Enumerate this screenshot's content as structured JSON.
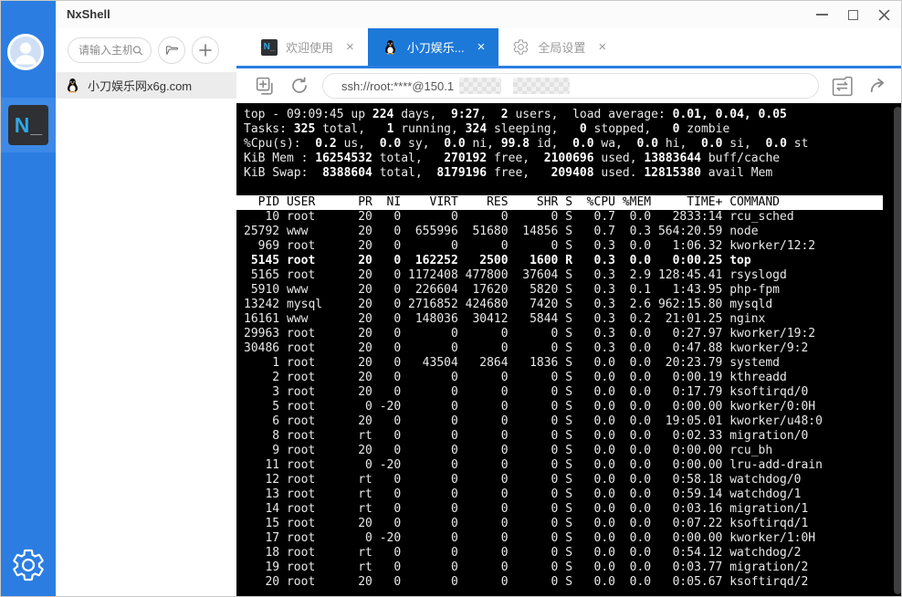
{
  "titlebar": {
    "app_title": "NxShell"
  },
  "logo": {
    "n": "N",
    "underscore": "_"
  },
  "host_panel": {
    "search_placeholder": "请输入主机",
    "host_item_label": "小刀娱乐网x6g.com"
  },
  "tabs": [
    {
      "label": "欢迎使用",
      "icon": "nxshell-logo",
      "close": "×",
      "active": false
    },
    {
      "label": "小刀娱乐...",
      "icon": "tux-penguin",
      "close": "×",
      "active": true
    },
    {
      "label": "全局设置",
      "icon": "gear",
      "close": "×",
      "active": false
    }
  ],
  "toolbar": {
    "address_visible": "ssh://root:****@150.1"
  },
  "colors": {
    "sidebar_blue": "#2b7de2",
    "active_tab_blue": "#1d79d8",
    "terminal_bg": "#000000",
    "terminal_text": "#e9e9e9"
  },
  "terminal": {
    "summary_lines": [
      [
        [
          "top - 09:09:45 up ",
          0
        ],
        [
          "224",
          1
        ],
        [
          " days,  ",
          0
        ],
        [
          "9:27",
          1
        ],
        [
          ",  ",
          0
        ],
        [
          "2",
          1
        ],
        [
          " users,  load average: ",
          0
        ],
        [
          "0.01, 0.04, 0.05",
          1
        ]
      ],
      [
        [
          "Tasks: ",
          0
        ],
        [
          "325",
          1
        ],
        [
          " total,   ",
          0
        ],
        [
          "1",
          1
        ],
        [
          " running, ",
          0
        ],
        [
          "324",
          1
        ],
        [
          " sleeping,   ",
          0
        ],
        [
          "0",
          1
        ],
        [
          " stopped,   ",
          0
        ],
        [
          "0",
          1
        ],
        [
          " zombie",
          0
        ]
      ],
      [
        [
          "%Cpu(s):  ",
          0
        ],
        [
          "0.2",
          1
        ],
        [
          " us,  ",
          0
        ],
        [
          "0.0",
          1
        ],
        [
          " sy,  ",
          0
        ],
        [
          "0.0",
          1
        ],
        [
          " ni, ",
          0
        ],
        [
          "99.8",
          1
        ],
        [
          " id,  ",
          0
        ],
        [
          "0.0",
          1
        ],
        [
          " wa,  ",
          0
        ],
        [
          "0.0",
          1
        ],
        [
          " hi,  ",
          0
        ],
        [
          "0.0",
          1
        ],
        [
          " si,  ",
          0
        ],
        [
          "0.0",
          1
        ],
        [
          " st",
          0
        ]
      ],
      [
        [
          "KiB Mem : ",
          0
        ],
        [
          "16254532",
          1
        ],
        [
          " total,   ",
          0
        ],
        [
          "270192",
          1
        ],
        [
          " free,  ",
          0
        ],
        [
          "2100696",
          1
        ],
        [
          " used, ",
          0
        ],
        [
          "13883644",
          1
        ],
        [
          " buff/cache",
          0
        ]
      ],
      [
        [
          "KiB Swap:  ",
          0
        ],
        [
          "8388604",
          1
        ],
        [
          " total,  ",
          0
        ],
        [
          "8179196",
          1
        ],
        [
          " free,   ",
          0
        ],
        [
          "209408",
          1
        ],
        [
          " used. ",
          0
        ],
        [
          "12815380",
          1
        ],
        [
          " avail Mem",
          0
        ]
      ]
    ],
    "table_columns": [
      "PID",
      "USER",
      "PR",
      "NI",
      "VIRT",
      "RES",
      "SHR",
      "S",
      "%CPU",
      "%MEM",
      "TIME+",
      "COMMAND"
    ],
    "highlight_row_index": 3,
    "process_rows": [
      [
        "10",
        "root",
        "20",
        "0",
        "0",
        "0",
        "0",
        "S",
        "0.7",
        "0.0",
        "2833:14",
        "rcu_sched"
      ],
      [
        "25792",
        "www",
        "20",
        "0",
        "655996",
        "51680",
        "14856",
        "S",
        "0.7",
        "0.3",
        "564:20.59",
        "node"
      ],
      [
        "969",
        "root",
        "20",
        "0",
        "0",
        "0",
        "0",
        "S",
        "0.3",
        "0.0",
        "1:06.32",
        "kworker/12:2"
      ],
      [
        "5145",
        "root",
        "20",
        "0",
        "162252",
        "2500",
        "1600",
        "R",
        "0.3",
        "0.0",
        "0:00.25",
        "top"
      ],
      [
        "5165",
        "root",
        "20",
        "0",
        "1172408",
        "477800",
        "37604",
        "S",
        "0.3",
        "2.9",
        "128:45.41",
        "rsyslogd"
      ],
      [
        "5910",
        "www",
        "20",
        "0",
        "226604",
        "17620",
        "5820",
        "S",
        "0.3",
        "0.1",
        "1:43.95",
        "php-fpm"
      ],
      [
        "13242",
        "mysql",
        "20",
        "0",
        "2716852",
        "424680",
        "7420",
        "S",
        "0.3",
        "2.6",
        "962:15.80",
        "mysqld"
      ],
      [
        "16161",
        "www",
        "20",
        "0",
        "148036",
        "30412",
        "5844",
        "S",
        "0.3",
        "0.2",
        "21:01.25",
        "nginx"
      ],
      [
        "29963",
        "root",
        "20",
        "0",
        "0",
        "0",
        "0",
        "S",
        "0.3",
        "0.0",
        "0:27.97",
        "kworker/19:2"
      ],
      [
        "30486",
        "root",
        "20",
        "0",
        "0",
        "0",
        "0",
        "S",
        "0.3",
        "0.0",
        "0:47.88",
        "kworker/9:2"
      ],
      [
        "1",
        "root",
        "20",
        "0",
        "43504",
        "2864",
        "1836",
        "S",
        "0.0",
        "0.0",
        "20:23.79",
        "systemd"
      ],
      [
        "2",
        "root",
        "20",
        "0",
        "0",
        "0",
        "0",
        "S",
        "0.0",
        "0.0",
        "0:00.19",
        "kthreadd"
      ],
      [
        "3",
        "root",
        "20",
        "0",
        "0",
        "0",
        "0",
        "S",
        "0.0",
        "0.0",
        "0:17.79",
        "ksoftirqd/0"
      ],
      [
        "5",
        "root",
        "0",
        "-20",
        "0",
        "0",
        "0",
        "S",
        "0.0",
        "0.0",
        "0:00.00",
        "kworker/0:0H"
      ],
      [
        "6",
        "root",
        "20",
        "0",
        "0",
        "0",
        "0",
        "S",
        "0.0",
        "0.0",
        "19:05.01",
        "kworker/u48:0"
      ],
      [
        "8",
        "root",
        "rt",
        "0",
        "0",
        "0",
        "0",
        "S",
        "0.0",
        "0.0",
        "0:02.33",
        "migration/0"
      ],
      [
        "9",
        "root",
        "20",
        "0",
        "0",
        "0",
        "0",
        "S",
        "0.0",
        "0.0",
        "0:00.00",
        "rcu_bh"
      ],
      [
        "11",
        "root",
        "0",
        "-20",
        "0",
        "0",
        "0",
        "S",
        "0.0",
        "0.0",
        "0:00.00",
        "lru-add-drain"
      ],
      [
        "12",
        "root",
        "rt",
        "0",
        "0",
        "0",
        "0",
        "S",
        "0.0",
        "0.0",
        "0:58.18",
        "watchdog/0"
      ],
      [
        "13",
        "root",
        "rt",
        "0",
        "0",
        "0",
        "0",
        "S",
        "0.0",
        "0.0",
        "0:59.14",
        "watchdog/1"
      ],
      [
        "14",
        "root",
        "rt",
        "0",
        "0",
        "0",
        "0",
        "S",
        "0.0",
        "0.0",
        "0:03.16",
        "migration/1"
      ],
      [
        "15",
        "root",
        "20",
        "0",
        "0",
        "0",
        "0",
        "S",
        "0.0",
        "0.0",
        "0:07.22",
        "ksoftirqd/1"
      ],
      [
        "17",
        "root",
        "0",
        "-20",
        "0",
        "0",
        "0",
        "S",
        "0.0",
        "0.0",
        "0:00.00",
        "kworker/1:0H"
      ],
      [
        "18",
        "root",
        "rt",
        "0",
        "0",
        "0",
        "0",
        "S",
        "0.0",
        "0.0",
        "0:54.12",
        "watchdog/2"
      ],
      [
        "19",
        "root",
        "rt",
        "0",
        "0",
        "0",
        "0",
        "S",
        "0.0",
        "0.0",
        "0:03.77",
        "migration/2"
      ],
      [
        "20",
        "root",
        "20",
        "0",
        "0",
        "0",
        "0",
        "S",
        "0.0",
        "0.0",
        "0:05.67",
        "ksoftirqd/2"
      ]
    ]
  }
}
